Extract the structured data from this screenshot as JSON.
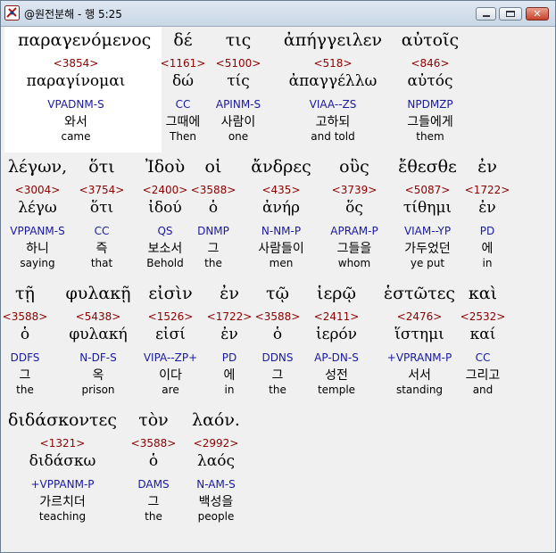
{
  "window": {
    "title": "@원전분해 - 행 5:25"
  },
  "rows": [
    {
      "words": [
        {
          "greek": "παραγενόμενος",
          "strong": "<3854>",
          "lemma": "παραγίνομαι",
          "parse": "VPADNM-S",
          "korean": "와서",
          "english": "came"
        },
        {
          "greek": "δέ",
          "strong": "<1161>",
          "lemma": "δώ",
          "parse": "CC",
          "korean": "그때에",
          "english": "Then"
        },
        {
          "greek": "τις",
          "strong": "<5100>",
          "lemma": "τίς",
          "parse": "APINM-S",
          "korean": "사람이",
          "english": "one"
        },
        {
          "greek": "ἀπήγγειλεν",
          "strong": "<518>",
          "lemma": "ἀπαγγέλλω",
          "parse": "VIAA--ZS",
          "korean": "고하되",
          "english": "and told"
        },
        {
          "greek": "αὐτοῖς",
          "strong": "<846>",
          "lemma": "αὐτός",
          "parse": "NPDMZP",
          "korean": "그들에게",
          "english": "them"
        }
      ]
    },
    {
      "words": [
        {
          "greek": "λέγων,",
          "strong": "<3004>",
          "lemma": "λέγω",
          "parse": "VPPANM-S",
          "korean": "하니",
          "english": "saying"
        },
        {
          "greek": "ὅτι",
          "strong": "<3754>",
          "lemma": "ὅτι",
          "parse": "CC",
          "korean": "즉",
          "english": "that"
        },
        {
          "greek": "Ἰδοὺ",
          "strong": "<2400>",
          "lemma": "ἰδού",
          "parse": "QS",
          "korean": "보소서",
          "english": "Behold"
        },
        {
          "greek": "οἱ",
          "strong": "<3588>",
          "lemma": "ὁ",
          "parse": "DNMP",
          "korean": "그",
          "english": "the"
        },
        {
          "greek": "ἄνδρες",
          "strong": "<435>",
          "lemma": "ἀνήρ",
          "parse": "N-NM-P",
          "korean": "사람들이",
          "english": "men"
        },
        {
          "greek": "οὓς",
          "strong": "<3739>",
          "lemma": "ὅς",
          "parse": "APRAM-P",
          "korean": "그들을",
          "english": "whom"
        },
        {
          "greek": "ἔθεσθε",
          "strong": "<5087>",
          "lemma": "τίθημι",
          "parse": "VIAM--YP",
          "korean": "가두었던",
          "english": "ye put"
        },
        {
          "greek": "ἐν",
          "strong": "<1722>",
          "lemma": "ἐν",
          "parse": "PD",
          "korean": "에",
          "english": "in"
        }
      ]
    },
    {
      "words": [
        {
          "greek": "τῇ",
          "strong": "<3588>",
          "lemma": "ὁ",
          "parse": "DDFS",
          "korean": "그",
          "english": "the"
        },
        {
          "greek": "φυλακῇ",
          "strong": "<5438>",
          "lemma": "φυλακή",
          "parse": "N-DF-S",
          "korean": "옥",
          "english": "prison"
        },
        {
          "greek": "εἰσὶν",
          "strong": "<1526>",
          "lemma": "εἰσί",
          "parse": "VIPA--ZP+",
          "korean": "이다",
          "english": "are"
        },
        {
          "greek": "ἐν",
          "strong": "<1722>",
          "lemma": "ἐν",
          "parse": "PD",
          "korean": "에",
          "english": "in"
        },
        {
          "greek": "τῷ",
          "strong": "<3588>",
          "lemma": "ὁ",
          "parse": "DDNS",
          "korean": "그",
          "english": "the"
        },
        {
          "greek": "ἱερῷ",
          "strong": "<2411>",
          "lemma": "ἱερόν",
          "parse": "AP-DN-S",
          "korean": "성전",
          "english": "temple"
        },
        {
          "greek": "ἑστῶτες",
          "strong": "<2476>",
          "lemma": "ἵστημι",
          "parse": "+VPRANM-P",
          "korean": "서서",
          "english": "standing"
        },
        {
          "greek": "καὶ",
          "strong": "<2532>",
          "lemma": "καί",
          "parse": "CC",
          "korean": "그리고",
          "english": "and"
        }
      ]
    },
    {
      "words": [
        {
          "greek": "διδάσκοντες",
          "strong": "<1321>",
          "lemma": "διδάσκω",
          "parse": "+VPPANM-P",
          "korean": "가르치더",
          "english": "teaching"
        },
        {
          "greek": "τὸν",
          "strong": "<3588>",
          "lemma": "ὁ",
          "parse": "DAMS",
          "korean": "그",
          "english": "the"
        },
        {
          "greek": "λαόν.",
          "strong": "<2992>",
          "lemma": "λαός",
          "parse": "N-AM-S",
          "korean": "백성을",
          "english": "people"
        }
      ]
    }
  ]
}
